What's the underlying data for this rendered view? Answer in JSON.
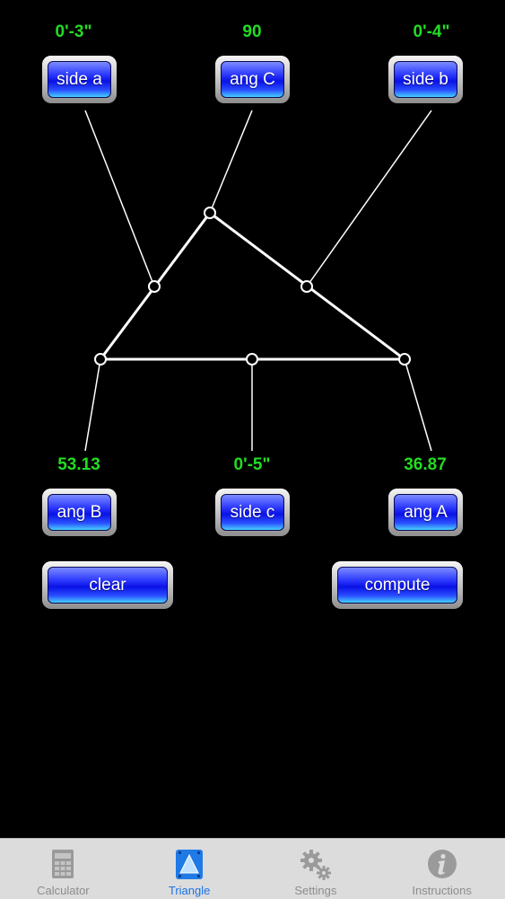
{
  "values": {
    "side_a": "0'-3\"",
    "ang_C": "90",
    "side_b": "0'-4\"",
    "ang_B": "53.13",
    "side_c": "0'-5\"",
    "ang_A": "36.87"
  },
  "buttons": {
    "side_a": "side a",
    "ang_C": "ang C",
    "side_b": "side b",
    "ang_B": "ang B",
    "side_c": "side c",
    "ang_A": "ang A",
    "clear": "clear",
    "compute": "compute"
  },
  "tabs": [
    {
      "label": "Calculator",
      "icon": "calculator-icon",
      "active": false
    },
    {
      "label": "Triangle",
      "icon": "triangle-icon",
      "active": true
    },
    {
      "label": "Settings",
      "icon": "gears-icon",
      "active": false
    },
    {
      "label": "Instructions",
      "icon": "info-icon",
      "active": false
    }
  ],
  "colors": {
    "background": "#000000",
    "value_text": "#22dd22",
    "button_blue": "#1a22ff",
    "tab_active": "#1a73e8",
    "tab_inactive": "#8c8c8c"
  }
}
